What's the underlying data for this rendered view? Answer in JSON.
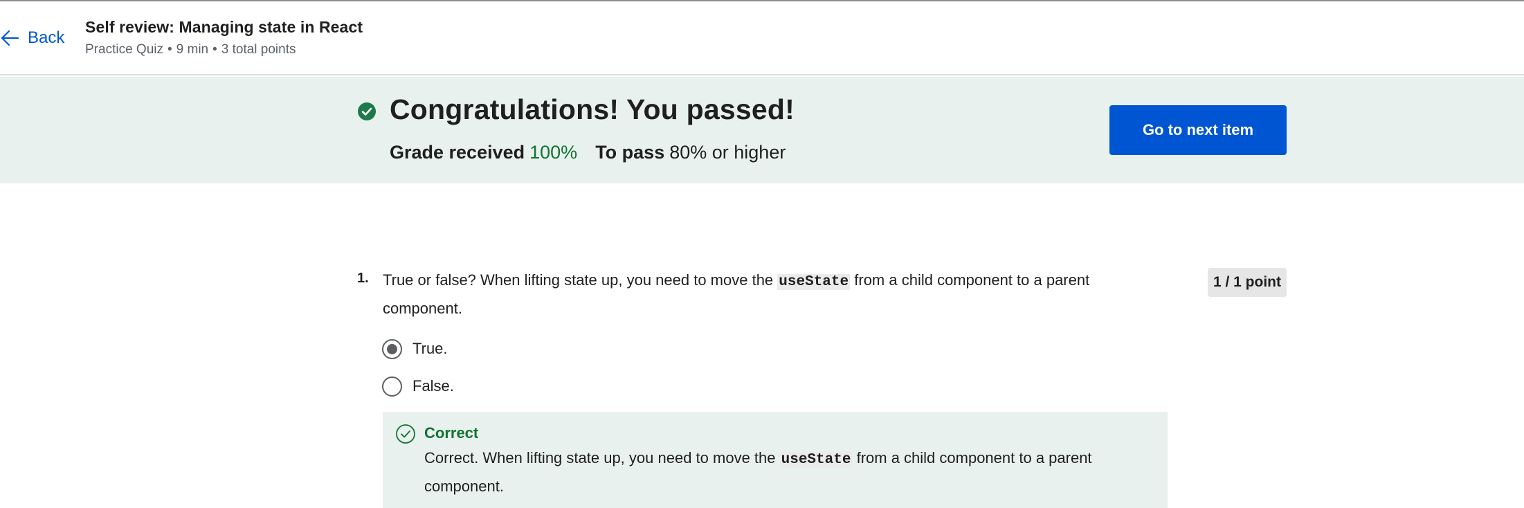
{
  "header": {
    "back_label": "Back",
    "title": "Self review: Managing state in React",
    "meta": {
      "type": "Practice Quiz",
      "sep1": "•",
      "duration": "9 min",
      "sep2": "•",
      "points": "3 total points"
    }
  },
  "banner": {
    "heading": "Congratulations! You passed!",
    "grade_label": "Grade received",
    "grade_value": "100%",
    "pass_label": "To pass",
    "pass_requirement": "80% or higher",
    "next_button": "Go to next item",
    "colors": {
      "accent": "#0056d2",
      "success": "#137333",
      "banner_bg": "#e8f1ed"
    }
  },
  "question": {
    "number": "1.",
    "text_before": "True or false? When lifting state up, you need to move the",
    "code": "useState",
    "text_after": "from a child component to a parent component.",
    "score": "1 / 1 point",
    "options": [
      {
        "label": "True.",
        "selected": true
      },
      {
        "label": "False.",
        "selected": false
      }
    ],
    "feedback": {
      "title": "Correct",
      "text_before": "Correct. When lifting state up, you need to move the",
      "code": "useState",
      "text_after": "from a child component to a parent component."
    }
  },
  "icons": {
    "back": "arrow-left-icon",
    "passed": "check-circle-filled-icon",
    "correct": "check-circle-outline-icon"
  }
}
